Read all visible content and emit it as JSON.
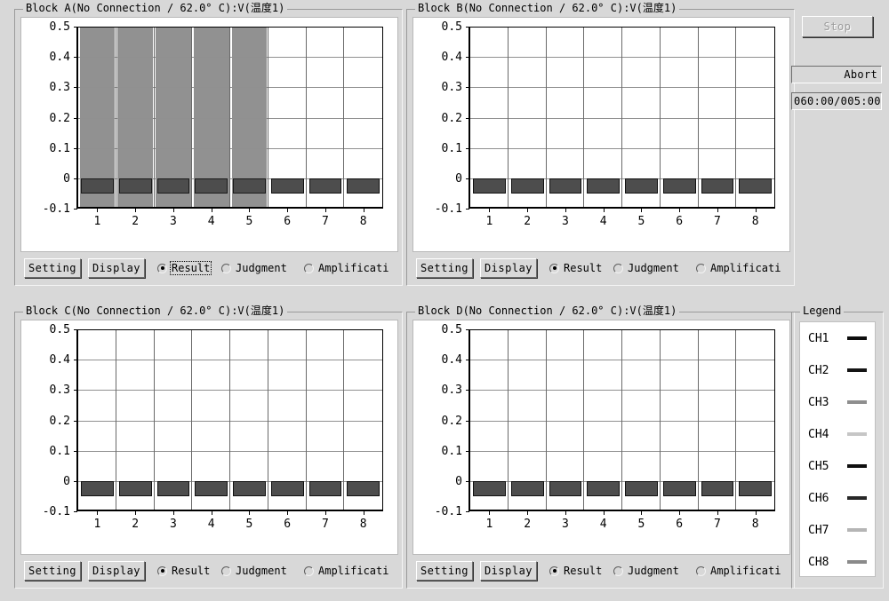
{
  "window": {
    "background": "#d8d8d8"
  },
  "blocks": [
    {
      "id": "a",
      "title_prefix": "Block A(No Connection / 62.0",
      "title_deg": "°",
      "title_mid": " C):V(",
      "title_cjk": "温度",
      "title_suffix": "1)",
      "title_full": "Block A(No Connection / 62.0° C):V(温度1)",
      "setting_label": "Setting",
      "display_label": "Display",
      "radios": [
        {
          "label": "Result",
          "selected": true,
          "focused": true
        },
        {
          "label": "Judgment",
          "selected": false,
          "focused": false
        },
        {
          "label": "Amplificati",
          "selected": false,
          "focused": false
        }
      ]
    },
    {
      "id": "b",
      "title_prefix": "Block B(No Connection / 62.0",
      "title_deg": "°",
      "title_mid": " C):V(",
      "title_cjk": "温度",
      "title_suffix": "1)",
      "title_full": "Block B(No Connection / 62.0° C):V(温度1)",
      "setting_label": "Setting",
      "display_label": "Display",
      "radios": [
        {
          "label": "Result",
          "selected": true,
          "focused": false
        },
        {
          "label": "Judgment",
          "selected": false,
          "focused": false
        },
        {
          "label": "Amplificati",
          "selected": false,
          "focused": false
        }
      ]
    },
    {
      "id": "c",
      "title_prefix": "Block C(No Connection / 62.0",
      "title_deg": "°",
      "title_mid": " C):V(",
      "title_cjk": "温度",
      "title_suffix": "1)",
      "title_full": "Block C(No Connection / 62.0° C):V(温度1)",
      "setting_label": "Setting",
      "display_label": "Display",
      "radios": [
        {
          "label": "Result",
          "selected": true,
          "focused": false
        },
        {
          "label": "Judgment",
          "selected": false,
          "focused": false
        },
        {
          "label": "Amplificati",
          "selected": false,
          "focused": false
        }
      ]
    },
    {
      "id": "d",
      "title_prefix": "Block D(No Connection / 62.0",
      "title_deg": "°",
      "title_mid": " C):V(",
      "title_cjk": "温度",
      "title_suffix": "1)",
      "title_full": "Block D(No Connection / 62.0° C):V(温度1)",
      "setting_label": "Setting",
      "display_label": "Display",
      "radios": [
        {
          "label": "Result",
          "selected": true,
          "focused": false
        },
        {
          "label": "Judgment",
          "selected": false,
          "focused": false
        },
        {
          "label": "Amplificati",
          "selected": false,
          "focused": false
        }
      ]
    }
  ],
  "controls": {
    "stop_label": "Stop",
    "stop_enabled": false,
    "abort_label": "Abort",
    "timer_value": "060:00/005:00"
  },
  "legend": {
    "title": "Legend",
    "items": [
      {
        "label": "CH1",
        "color": "#0d0d0d"
      },
      {
        "label": "CH2",
        "color": "#141414"
      },
      {
        "label": "CH3",
        "color": "#8e8e8e"
      },
      {
        "label": "CH4",
        "color": "#c6c6c6"
      },
      {
        "label": "CH5",
        "color": "#0f0f0f"
      },
      {
        "label": "CH6",
        "color": "#272727"
      },
      {
        "label": "CH7",
        "color": "#b5b5b5"
      },
      {
        "label": "CH8",
        "color": "#8a8a8a"
      }
    ]
  },
  "chart_data": [
    {
      "type": "bar",
      "title": "Block A(No Connection / 62.0° C):V(温度1)",
      "xlabel": "",
      "ylabel": "",
      "categories": [
        "1",
        "2",
        "3",
        "4",
        "5",
        "6",
        "7",
        "8"
      ],
      "values": [
        -0.05,
        -0.05,
        -0.05,
        -0.05,
        -0.05,
        -0.05,
        -0.05,
        -0.05
      ],
      "ylim": [
        -0.1,
        0.5
      ],
      "yticks": [
        0.5,
        0.4,
        0.3,
        0.2,
        0.1,
        0,
        -0.1
      ],
      "ytick_labels": [
        "0.5",
        "0.4",
        "0.3",
        "0.2",
        "0.1",
        "0",
        "-0.1"
      ],
      "grid": true,
      "legend_position": "external-right",
      "selected_categories": [
        "1",
        "2",
        "3",
        "4",
        "5"
      ],
      "selection_color": "#919191",
      "bar_color": "#4d4d4d"
    },
    {
      "type": "bar",
      "title": "Block B(No Connection / 62.0° C):V(温度1)",
      "xlabel": "",
      "ylabel": "",
      "categories": [
        "1",
        "2",
        "3",
        "4",
        "5",
        "6",
        "7",
        "8"
      ],
      "values": [
        -0.05,
        -0.05,
        -0.05,
        -0.05,
        -0.05,
        -0.05,
        -0.05,
        -0.05
      ],
      "ylim": [
        -0.1,
        0.5
      ],
      "yticks": [
        0.5,
        0.4,
        0.3,
        0.2,
        0.1,
        0,
        -0.1
      ],
      "ytick_labels": [
        "0.5",
        "0.4",
        "0.3",
        "0.2",
        "0.1",
        "0",
        "-0.1"
      ],
      "grid": true,
      "legend_position": "external-right",
      "selected_categories": [],
      "selection_color": "#919191",
      "bar_color": "#4d4d4d"
    },
    {
      "type": "bar",
      "title": "Block C(No Connection / 62.0° C):V(温度1)",
      "xlabel": "",
      "ylabel": "",
      "categories": [
        "1",
        "2",
        "3",
        "4",
        "5",
        "6",
        "7",
        "8"
      ],
      "values": [
        -0.05,
        -0.05,
        -0.05,
        -0.05,
        -0.05,
        -0.05,
        -0.05,
        -0.05
      ],
      "ylim": [
        -0.1,
        0.5
      ],
      "yticks": [
        0.5,
        0.4,
        0.3,
        0.2,
        0.1,
        0,
        -0.1
      ],
      "ytick_labels": [
        "0.5",
        "0.4",
        "0.3",
        "0.2",
        "0.1",
        "0",
        "-0.1"
      ],
      "grid": true,
      "legend_position": "external-right",
      "selected_categories": [],
      "selection_color": "#919191",
      "bar_color": "#4d4d4d"
    },
    {
      "type": "bar",
      "title": "Block D(No Connection / 62.0° C):V(温度1)",
      "xlabel": "",
      "ylabel": "",
      "categories": [
        "1",
        "2",
        "3",
        "4",
        "5",
        "6",
        "7",
        "8"
      ],
      "values": [
        -0.05,
        -0.05,
        -0.05,
        -0.05,
        -0.05,
        -0.05,
        -0.05,
        -0.05
      ],
      "ylim": [
        -0.1,
        0.5
      ],
      "yticks": [
        0.5,
        0.4,
        0.3,
        0.2,
        0.1,
        0,
        -0.1
      ],
      "ytick_labels": [
        "0.5",
        "0.4",
        "0.3",
        "0.2",
        "0.1",
        "0",
        "-0.1"
      ],
      "grid": true,
      "legend_position": "external-right",
      "selected_categories": [],
      "selection_color": "#919191",
      "bar_color": "#4d4d4d"
    }
  ]
}
